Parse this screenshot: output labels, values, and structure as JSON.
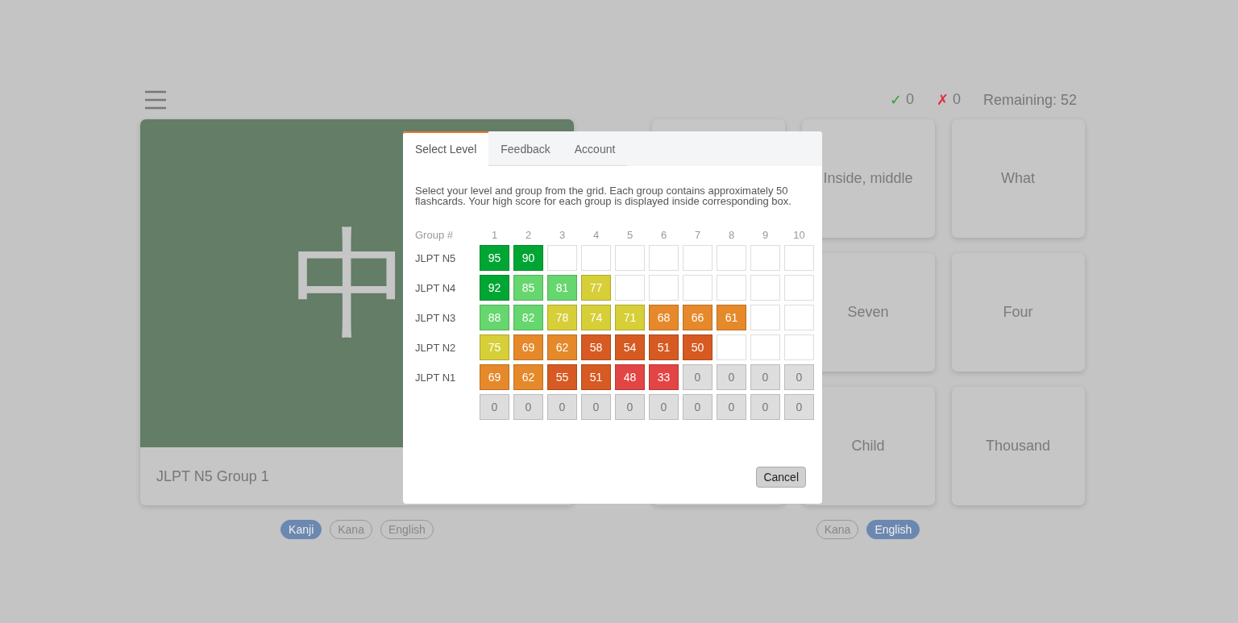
{
  "stats": {
    "correct_mark": "✓",
    "correct": "0",
    "wrong_mark": "✗",
    "wrong": "0",
    "remaining": "Remaining: 52"
  },
  "flashcard": {
    "character": "中",
    "caption": "JLPT N5 Group 1"
  },
  "front_modes": [
    {
      "label": "Kanji",
      "selected": true
    },
    {
      "label": "Kana",
      "selected": false
    },
    {
      "label": "English",
      "selected": false
    }
  ],
  "answers": [
    {
      "kind": "covered"
    },
    {
      "kind": "answer",
      "label": "Inside, middle"
    },
    {
      "kind": "answer",
      "label": "What"
    },
    {
      "kind": "gap"
    },
    {
      "kind": "answer",
      "label": "Seven"
    },
    {
      "kind": "answer",
      "label": "Four"
    },
    {
      "kind": "covered"
    },
    {
      "kind": "answer",
      "label": "Child"
    },
    {
      "kind": "answer",
      "label": "Thousand"
    }
  ],
  "back_modes": [
    {
      "label": "Kana",
      "selected": false
    },
    {
      "label": "English",
      "selected": true
    }
  ],
  "dialog": {
    "tabs": [
      {
        "label": "Select Level",
        "selected": true
      },
      {
        "label": "Feedback",
        "selected": false
      },
      {
        "label": "Account",
        "selected": false
      }
    ],
    "intro": "Select your level and group from the grid. Each group contains approximately 50 flashcards. Your high score for each group is displayed inside corresponding box.",
    "corner_label": "Group #",
    "columns": [
      "1",
      "2",
      "3",
      "4",
      "5",
      "6",
      "7",
      "8",
      "9",
      "10"
    ],
    "rows": [
      {
        "label": "JLPT N5",
        "cells": [
          {
            "kind": "score",
            "score": "95",
            "color": "#00a633"
          },
          {
            "kind": "score",
            "score": "90",
            "color": "#00a633"
          },
          {
            "kind": "empty"
          },
          {
            "kind": "empty"
          },
          {
            "kind": "empty"
          },
          {
            "kind": "empty"
          },
          {
            "kind": "empty"
          },
          {
            "kind": "empty"
          },
          {
            "kind": "empty"
          },
          {
            "kind": "empty"
          }
        ]
      },
      {
        "label": "JLPT N4",
        "cells": [
          {
            "kind": "score",
            "score": "92",
            "color": "#00a633"
          },
          {
            "kind": "score",
            "score": "85",
            "color": "#66d66e"
          },
          {
            "kind": "score",
            "score": "81",
            "color": "#66d66e"
          },
          {
            "kind": "score",
            "score": "77",
            "color": "#d6cf38"
          },
          {
            "kind": "empty"
          },
          {
            "kind": "empty"
          },
          {
            "kind": "empty"
          },
          {
            "kind": "empty"
          },
          {
            "kind": "empty"
          },
          {
            "kind": "empty"
          }
        ]
      },
      {
        "label": "JLPT N3",
        "cells": [
          {
            "kind": "score",
            "score": "88",
            "color": "#66d66e"
          },
          {
            "kind": "score",
            "score": "82",
            "color": "#66d66e"
          },
          {
            "kind": "score",
            "score": "78",
            "color": "#d6cf38"
          },
          {
            "kind": "score",
            "score": "74",
            "color": "#d6cf38"
          },
          {
            "kind": "score",
            "score": "71",
            "color": "#d6cf38"
          },
          {
            "kind": "score",
            "score": "68",
            "color": "#e5892a"
          },
          {
            "kind": "score",
            "score": "66",
            "color": "#e5892a"
          },
          {
            "kind": "score",
            "score": "61",
            "color": "#e5892a"
          },
          {
            "kind": "empty"
          },
          {
            "kind": "empty"
          }
        ]
      },
      {
        "label": "JLPT N2",
        "cells": [
          {
            "kind": "score",
            "score": "75",
            "color": "#d6cf38"
          },
          {
            "kind": "score",
            "score": "69",
            "color": "#e5892a"
          },
          {
            "kind": "score",
            "score": "62",
            "color": "#e5892a"
          },
          {
            "kind": "score",
            "score": "58",
            "color": "#d65a22"
          },
          {
            "kind": "score",
            "score": "54",
            "color": "#d65a22"
          },
          {
            "kind": "score",
            "score": "51",
            "color": "#d65a22"
          },
          {
            "kind": "score",
            "score": "50",
            "color": "#d65a22"
          },
          {
            "kind": "empty"
          },
          {
            "kind": "empty"
          },
          {
            "kind": "empty"
          }
        ]
      },
      {
        "label": "JLPT N1",
        "cells": [
          {
            "kind": "score",
            "score": "69",
            "color": "#e5892a"
          },
          {
            "kind": "score",
            "score": "62",
            "color": "#e5892a"
          },
          {
            "kind": "score",
            "score": "55",
            "color": "#d65a22"
          },
          {
            "kind": "score",
            "score": "51",
            "color": "#d65a22"
          },
          {
            "kind": "score",
            "score": "48",
            "color": "#e34444"
          },
          {
            "kind": "score",
            "score": "33",
            "color": "#e34444"
          },
          {
            "kind": "zero",
            "score": "0",
            "color": "#dddddd"
          },
          {
            "kind": "zero",
            "score": "0",
            "color": "#dddddd"
          },
          {
            "kind": "zero",
            "score": "0",
            "color": "#dddddd"
          },
          {
            "kind": "zero",
            "score": "0",
            "color": "#dddddd"
          }
        ]
      },
      {
        "cells": [
          {
            "kind": "zero",
            "score": "0",
            "color": "#dddddd"
          },
          {
            "kind": "zero",
            "score": "0",
            "color": "#dddddd"
          },
          {
            "kind": "zero",
            "score": "0",
            "color": "#dddddd"
          },
          {
            "kind": "zero",
            "score": "0",
            "color": "#dddddd"
          },
          {
            "kind": "zero",
            "score": "0",
            "color": "#dddddd"
          },
          {
            "kind": "zero",
            "score": "0",
            "color": "#dddddd"
          },
          {
            "kind": "zero",
            "score": "0",
            "color": "#dddddd"
          },
          {
            "kind": "zero",
            "score": "0",
            "color": "#dddddd"
          },
          {
            "kind": "zero",
            "score": "0",
            "color": "#dddddd"
          },
          {
            "kind": "zero",
            "score": "0",
            "color": "#dddddd"
          }
        ]
      }
    ],
    "cancel": "Cancel"
  }
}
